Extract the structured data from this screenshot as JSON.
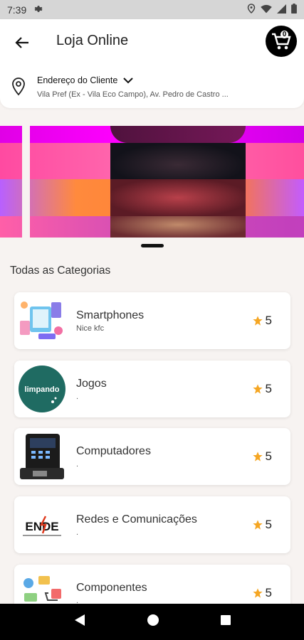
{
  "status_bar": {
    "time": "7:39"
  },
  "header": {
    "title": "Loja Online",
    "cart_count": "0"
  },
  "address": {
    "label": "Endereço do Cliente",
    "value": "Vila Pref (Ex - Vila Eco Campo), Av. Pedro de Castro ..."
  },
  "section": {
    "title": "Todas as Categorias"
  },
  "categories": [
    {
      "name": "Smartphones",
      "subtitle": "Nice kfc",
      "rating": "5"
    },
    {
      "name": "Jogos",
      "subtitle": ".",
      "rating": "5",
      "logo_text": "limpando"
    },
    {
      "name": "Computadores",
      "subtitle": ".",
      "rating": "5"
    },
    {
      "name": "Redes e Comunicações",
      "subtitle": ".",
      "rating": "5",
      "logo_text": "ENDE"
    },
    {
      "name": "Componentes",
      "subtitle": ".",
      "rating": "5"
    }
  ],
  "colors": {
    "accent_star": "#f5a623",
    "banner_magenta": "#e100ff",
    "banner_pink": "#ff5fa8",
    "banner_orange": "#ff8a3d"
  }
}
